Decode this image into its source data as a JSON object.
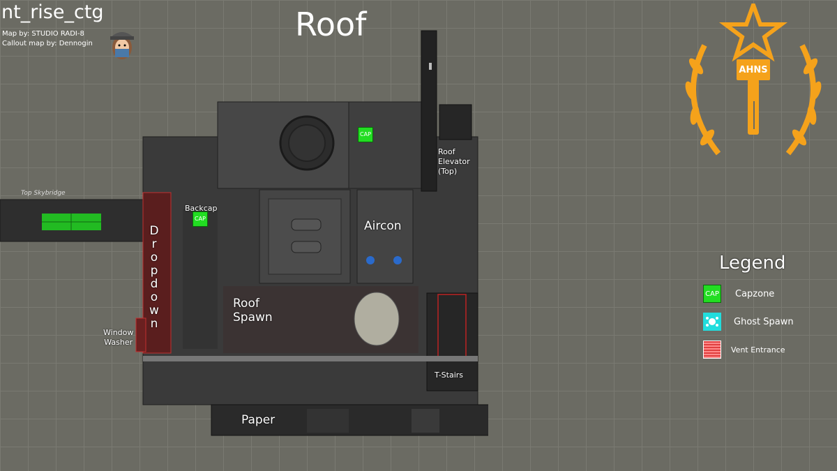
{
  "header": {
    "map_name": "nt_rise_ctg",
    "map_by": "Map by: STUDIO RADI-8",
    "callout_by": "Callout map by: Dennogin"
  },
  "title": "Roof",
  "callouts": {
    "top_skybridge": "Top Skybridge",
    "backcap": "Backcap",
    "aircon": "Aircon",
    "roof_elevator": [
      "Roof",
      "Elevator",
      "(Top)"
    ],
    "dropdown": "Dropdown",
    "roof_spawn": [
      "Roof",
      "Spawn"
    ],
    "window_washer": [
      "Window",
      "Washer"
    ],
    "t_stairs": "T-Stairs",
    "paper": "Paper"
  },
  "cap_label": "CAP",
  "logo": {
    "text": "AHNS",
    "color": "#f5a21b",
    "icon": "star-wreath-hammer-emblem"
  },
  "legend": {
    "title": "Legend",
    "items": [
      {
        "label": "Capzone",
        "swatch": "CAP",
        "color": "#22dd22",
        "icon": "cap-icon"
      },
      {
        "label": "Ghost Spawn",
        "swatch": "",
        "color": "#22dddd",
        "icon": "ghost-icon"
      },
      {
        "label": "Vent Entrance",
        "swatch": "",
        "color": "#e04040",
        "icon": "vent-icon"
      }
    ]
  }
}
